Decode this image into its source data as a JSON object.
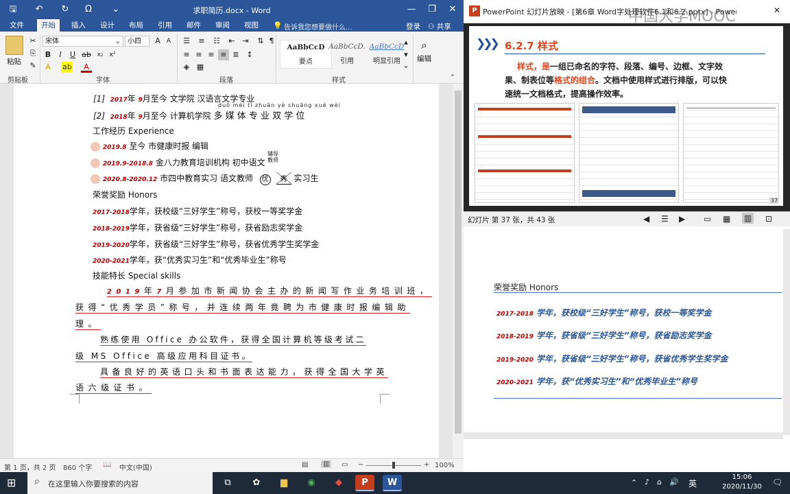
{
  "word": {
    "title": "求职简历.docx - Word",
    "window_controls": [
      "—",
      "❐",
      "✕"
    ],
    "tabs": [
      "文件",
      "开始",
      "插入",
      "设计",
      "布局",
      "引用",
      "邮件",
      "审阅",
      "视图"
    ],
    "tell_me": "告诉我您想要做什么...",
    "login": "登录",
    "share": "共享",
    "ribbon": {
      "paste": "粘贴",
      "clipboard": "剪贴板",
      "font_name": "宋体",
      "font_size": "小四",
      "font_group": "字体",
      "paragraph_group": "段落",
      "styles_group": "样式",
      "editing_group": "编辑",
      "styles": [
        {
          "sample": "AaBbCcD",
          "name": "要点"
        },
        {
          "sample": "AaBbCcD.",
          "name": "引用"
        },
        {
          "sample": "AaBbCcD",
          "name": "明显引用"
        }
      ]
    },
    "doc": {
      "edu1_num": "[1]",
      "edu1_year": "2017",
      "edu1_mon": "9",
      "edu1_text": "月至今 文学院 汉语言文学专业",
      "edu2_num": "[2]",
      "edu2_year": "2018",
      "edu2_mon": "9",
      "edu2_text": "月至今 计算机学院",
      "edu2_ruby": "duō méi tǐ zhuān yè shuāng xué wèi",
      "edu2_big": "多 媒 体 专 业 双 学 位",
      "work_title": "工作经历 Experience",
      "work1_date": "2019.8",
      "work1_text": "至今 市健康时报 编辑",
      "work2_date": "2019.9-2018.8",
      "work2_text": "金八力教育培训机构 初中语文",
      "work2_ruby": "辅导教师",
      "work3_date": "2020.8-2020.12",
      "work3_text": "市四中教育实习 语文教师",
      "work3_circled1": "优",
      "work3_circled2": "秀",
      "work3_tail": "实习生",
      "honors_title": "荣誉奖励 Honors",
      "honors": [
        {
          "year": "2017-2018",
          "text": "学年，获校级“三好学生”称号，获校一等奖学金"
        },
        {
          "year": "2018-2019",
          "text": "学年，获省级“三好学生”称号，获省励志奖学金"
        },
        {
          "year": "2019-2020",
          "text": "学年，获省级“三好学生”称号，获省优秀学生奖学金"
        },
        {
          "year": "2020-2021",
          "text": "学年，获“优秀实习生”和“优秀毕业生”称号"
        }
      ],
      "skills_title": "技能特长 Special skills",
      "p1a_year": "2019",
      "p1a_nian": "年",
      "p1a_mon": "7",
      "p1a_text": "月参加市新闻协会主办的新闻写作业务培训班，",
      "p1b": "获得“优秀学员”称号，并连续两年竟聘为市健康时报编辑助",
      "p1c": "理。",
      "p2a": "熟练使用 Office 办公软件，获得全国计算机等级考试二",
      "p2b": "级 MS Office 高级应用科目证书。",
      "p3a": "具备良好的英语口头和书面表达能力，获得全国大学英",
      "p3b": "语六级证书。"
    },
    "status": {
      "page": "第 1 页，共 2 页",
      "words": "860 个字",
      "lang": "中文(中国)",
      "zoom": "100%"
    }
  },
  "ppt": {
    "title": "PowerPoint 幻灯片放映 - [第6章 Word字处理软件6.1和6.2.pptx] - PowerP...",
    "watermark": "中国大学MOOC",
    "slide": {
      "heading": "6.2.7  样式",
      "body_l1_a": "样式，是",
      "body_l1_b": "一组已命名的字符、段落、编号、边框、文字效",
      "body_l2_a": "果、制表位等",
      "body_l2_b": "格式的组合",
      "body_l2_c": "。文档中使用样式进行排版，可以快",
      "body_l3": "速统一文档格式，提高操作效率。",
      "page_num": "37"
    },
    "status": "幻灯片 第 37 张，共 43 张",
    "notes": {
      "honors_title": "荣誉奖励 Honors",
      "honors": [
        {
          "year": "2017-2018",
          "text": "学年，获校级“三好学生”称号，获校一等奖学金"
        },
        {
          "year": "2018-2019",
          "text": "学年，获省级“三好学生”称号，获省励志奖学金"
        },
        {
          "year": "2019-2020",
          "text": "学年，获省级“三好学生”称号，获省优秀学生奖学金"
        },
        {
          "year": "2020-2021",
          "text": "学年，获“优秀实习生”和“优秀毕业生”称号"
        }
      ]
    }
  },
  "taskbar": {
    "search_placeholder": "在这里输入你要搜索的内容",
    "ime": "英",
    "time": "15:06",
    "date": "2020/11/30"
  },
  "colors": {
    "word_blue": "#2b579a",
    "ppt_red": "#c43e1c",
    "slide_blue": "#1f4e9a",
    "slide_red": "#e8421b",
    "taskbar": "#1f2a38"
  }
}
